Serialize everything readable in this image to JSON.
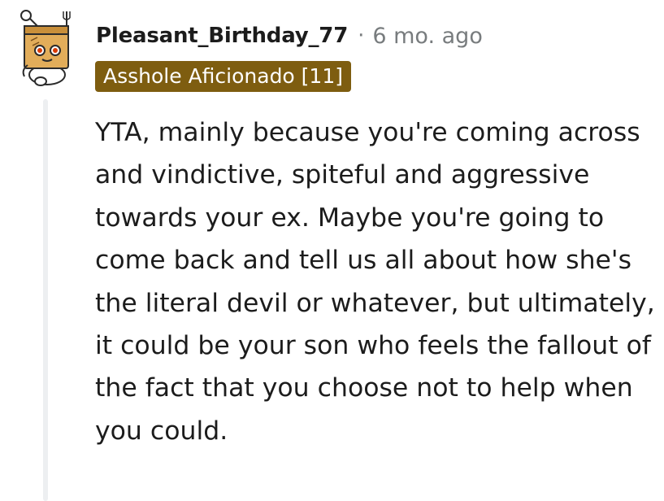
{
  "comment": {
    "author": "Pleasant_Birthday_77",
    "separator": "·",
    "timestamp": "6 mo. ago",
    "flair": "Asshole Aficionado [11]",
    "body": "YTA, mainly because you're coming across and vindictive, spiteful and aggressive towards your ex. Maybe you're going to come back and tell us all about how she's the literal devil or whatever, but ultimately, it could be your son who feels the fallout of the fact that you choose not to help when you could."
  },
  "colors": {
    "flair_background": "#7e5d10",
    "flair_text": "#ffffff",
    "meta_text": "#787c7e",
    "body_text": "#1c1c1c",
    "thread_line": "#edeff1"
  },
  "icons": {
    "avatar": "snoo-avatar-icon"
  }
}
